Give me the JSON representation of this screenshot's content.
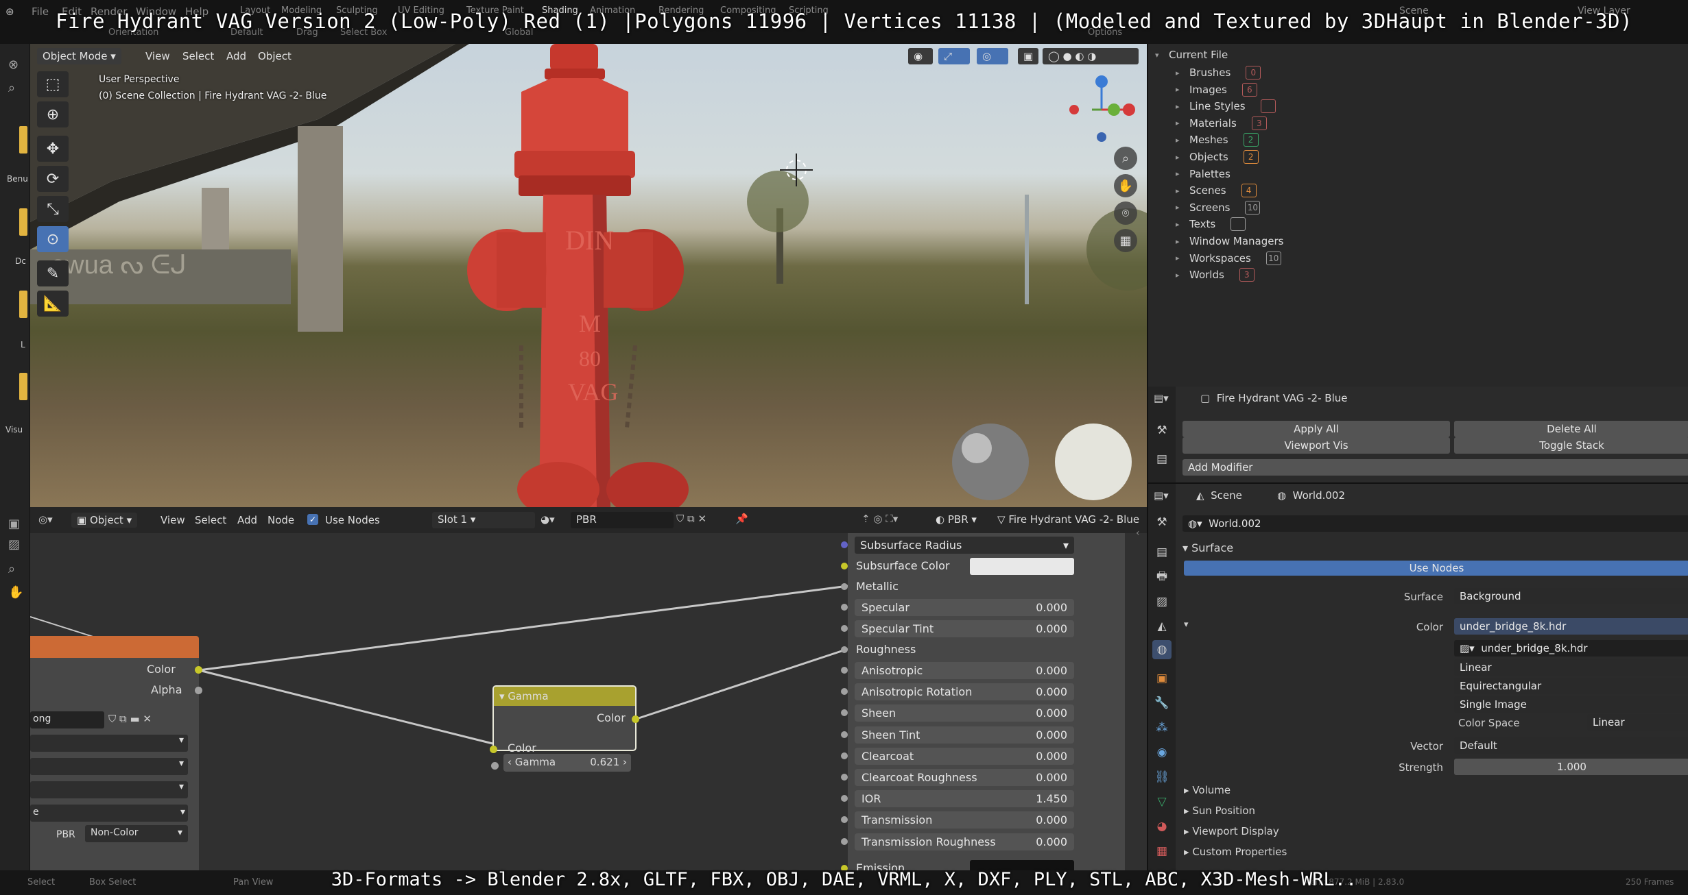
{
  "banners": {
    "top": "Fire Hydrant VAG Version 2 (Low-Poly) Red (1) |Polygons 11996 | Vertices 11138 | (Modeled and Textured by 3DHaupt in Blender-3D)",
    "bottom": "3D-Formats -> Blender 2.8x, GLTF, FBX, OBJ, DAE, VRML, X, DXF, PLY, STL, ABC, X3D-Mesh-WRL.."
  },
  "topbar": {
    "menus": [
      "File",
      "Edit",
      "Render",
      "Window",
      "Help"
    ],
    "workspaces": [
      "Layout",
      "Modeling",
      "Sculpting",
      "UV Editing",
      "Texture Paint",
      "Shading",
      "Animation",
      "Rendering",
      "Compositing",
      "Scripting"
    ],
    "scene": "Scene",
    "view_layer": "View Layer"
  },
  "viewport": {
    "header": {
      "mode": "Object Mode",
      "view": "View",
      "select": "Select",
      "add": "Add",
      "object": "Object",
      "orientation": "Orientation",
      "transform": "Default",
      "drag": "Drag",
      "select_box": "Select Box",
      "global": "Global",
      "options": "Options"
    },
    "overlay_line1": "User Perspective",
    "overlay_line2": "(0) Scene Collection | Fire Hydrant VAG -2- Blue",
    "hydrant_text": {
      "din": "DIN",
      "m": "M",
      "num": "80",
      "vag": "VAG"
    }
  },
  "outliner": {
    "root": "Current File",
    "items": [
      {
        "label": "Brushes",
        "icon": "brush-icon",
        "color": "#b35a5a",
        "count": "0"
      },
      {
        "label": "Images",
        "icon": "image-icon",
        "color": "#b35a5a",
        "count": "6"
      },
      {
        "label": "Line Styles",
        "icon": "linestyle-icon",
        "color": "#b35a5a",
        "count": ""
      },
      {
        "label": "Materials",
        "icon": "material-icon",
        "color": "#b35a5a",
        "count": "3"
      },
      {
        "label": "Meshes",
        "icon": "mesh-icon",
        "color": "#3aa869",
        "count": "2"
      },
      {
        "label": "Objects",
        "icon": "object-icon",
        "color": "#e08c3c",
        "count": "2"
      },
      {
        "label": "Palettes",
        "icon": "",
        "color": "",
        "count": ""
      },
      {
        "label": "Scenes",
        "icon": "scene-icon",
        "color": "#e08c3c",
        "count": "4"
      },
      {
        "label": "Screens",
        "icon": "screen-icon",
        "color": "#9a9a9a",
        "count": "10"
      },
      {
        "label": "Texts",
        "icon": "text-icon",
        "color": "#9a9a9a",
        "count": ""
      },
      {
        "label": "Window Managers",
        "icon": "",
        "color": "",
        "count": ""
      },
      {
        "label": "Workspaces",
        "icon": "workspace-icon",
        "color": "#9a9a9a",
        "count": "10"
      },
      {
        "label": "Worlds",
        "icon": "world-icon",
        "color": "#b35a5a",
        "count": "3"
      }
    ]
  },
  "modifiers": {
    "object_name": "Fire Hydrant VAG -2- Blue",
    "apply_all": "Apply All",
    "delete_all": "Delete All",
    "viewport_vis": "Viewport Vis",
    "toggle_stack": "Toggle Stack",
    "add_modifier": "Add Modifier"
  },
  "world_props": {
    "scene": "Scene",
    "world": "World.002",
    "world_field": "World.002",
    "surface_panel": "Surface",
    "use_nodes": "Use Nodes",
    "surface_label": "Surface",
    "surface_value": "Background",
    "color_label": "Color",
    "color_value": "under_bridge_8k.hdr",
    "image_name": "under_bridge_8k.hdr",
    "interp": "Linear",
    "projection": "Equirectangular",
    "source": "Single Image",
    "color_space_label": "Color Space",
    "color_space_value": "Linear",
    "vector_label": "Vector",
    "vector_value": "Default",
    "strength_label": "Strength",
    "strength_value": "1.000",
    "panels": [
      "Volume",
      "Sun Position",
      "Viewport Display",
      "Custom Properties"
    ]
  },
  "node_editor": {
    "header": {
      "object": "Object",
      "view": "View",
      "select": "Select",
      "add": "Add",
      "node": "Node",
      "use_nodes": "Use Nodes",
      "slot": "Slot 1",
      "material": "PBR",
      "pbr": "PBR",
      "object_name": "Fire Hydrant VAG -2- Blue"
    },
    "image_node": {
      "color": "Color",
      "alpha": "Alpha",
      "file": "ong",
      "dropdown_last": "e",
      "pbr": "PBR",
      "colorspace": "Non-Color"
    },
    "gamma_node": {
      "title": "Gamma",
      "out": "Color",
      "in": "Color",
      "gamma_label": "Gamma",
      "gamma_value": "0.621"
    },
    "principled": {
      "subsurface_radius": "Subsurface Radius",
      "subsurface_color": "Subsurface Color",
      "metallic": "Metallic",
      "roughness": "Roughness",
      "emission": "Emission",
      "fields": [
        {
          "label": "Specular",
          "value": "0.000"
        },
        {
          "label": "Specular Tint",
          "value": "0.000"
        },
        {
          "label": "Anisotropic",
          "value": "0.000"
        },
        {
          "label": "Anisotropic Rotation",
          "value": "0.000"
        },
        {
          "label": "Sheen",
          "value": "0.000"
        },
        {
          "label": "Sheen Tint",
          "value": "0.000"
        },
        {
          "label": "Clearcoat",
          "value": "0.000"
        },
        {
          "label": "Clearcoat Roughness",
          "value": "0.000"
        },
        {
          "label": "IOR",
          "value": "1.450"
        },
        {
          "label": "Transmission",
          "value": "0.000"
        },
        {
          "label": "Transmission Roughness",
          "value": "0.000"
        }
      ]
    }
  },
  "left_sidebar_labels": [
    "Benu",
    "Dc",
    "L",
    "Visu"
  ],
  "status": {
    "select": "Select",
    "box_select": "Box Select",
    "pan": "Pan View",
    "mem": "Mem: 877.2 MiB | 2.83.0",
    "frames": "250 Frames"
  }
}
